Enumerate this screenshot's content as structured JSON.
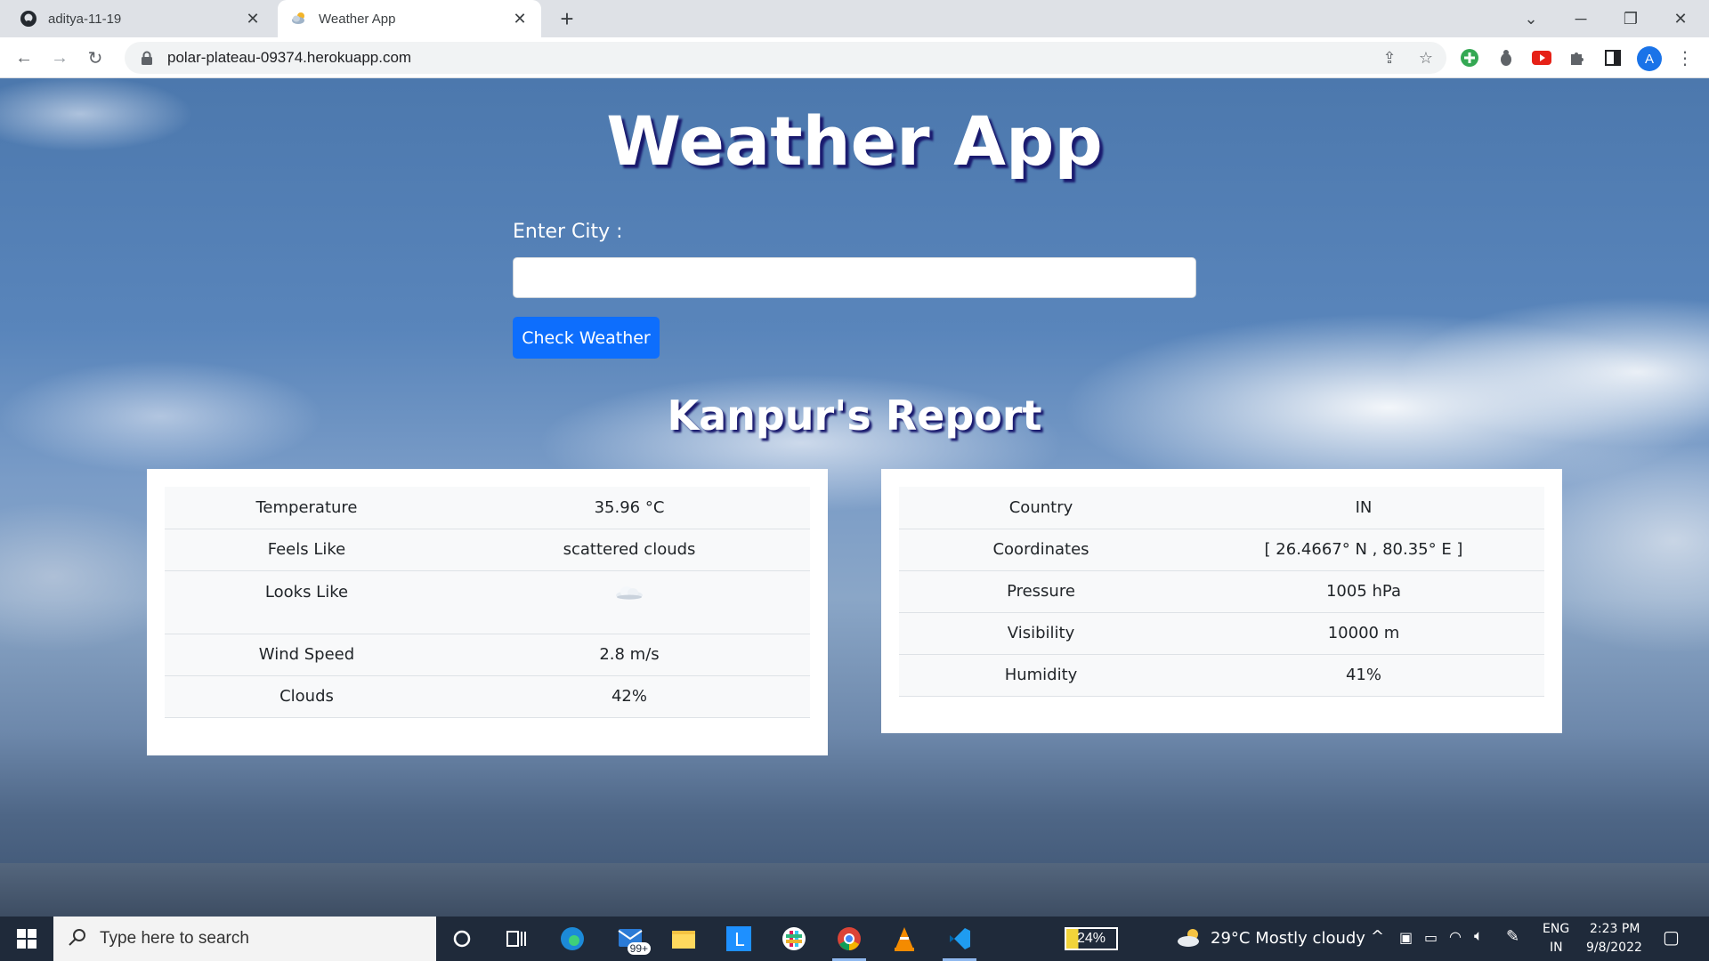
{
  "browser": {
    "tabs": [
      {
        "title": "aditya-11-19",
        "icon": "github-icon",
        "active": false
      },
      {
        "title": "Weather App",
        "icon": "weather-favicon",
        "active": true
      }
    ],
    "url": "polar-plateau-09374.herokuapp.com",
    "profile_initial": "A"
  },
  "page": {
    "app_title": "Weather App",
    "city_label": "Enter City :",
    "city_input_value": "",
    "check_button": "Check Weather",
    "report_title": "Kanpur's Report",
    "left_table": [
      {
        "key": "Temperature",
        "value": "35.96 °C"
      },
      {
        "key": "Feels Like",
        "value": "scattered clouds"
      },
      {
        "key": "Looks Like",
        "value": "",
        "icon": "cloud-icon"
      },
      {
        "key": "Wind Speed",
        "value": "2.8 m/s"
      },
      {
        "key": "Clouds",
        "value": "42%"
      }
    ],
    "right_table": [
      {
        "key": "Country",
        "value": "IN"
      },
      {
        "key": "Coordinates",
        "value": "[ 26.4667° N , 80.35° E ]"
      },
      {
        "key": "Pressure",
        "value": "1005 hPa"
      },
      {
        "key": "Visibility",
        "value": "10000 m"
      },
      {
        "key": "Humidity",
        "value": "41%"
      }
    ]
  },
  "taskbar": {
    "search_placeholder": "Type here to search",
    "mail_badge": "99+",
    "battery": "24%",
    "weather": "29°C  Mostly cloudy",
    "lang_top": "ENG",
    "lang_bottom": "IN",
    "time": "2:23 PM",
    "date": "9/8/2022"
  }
}
